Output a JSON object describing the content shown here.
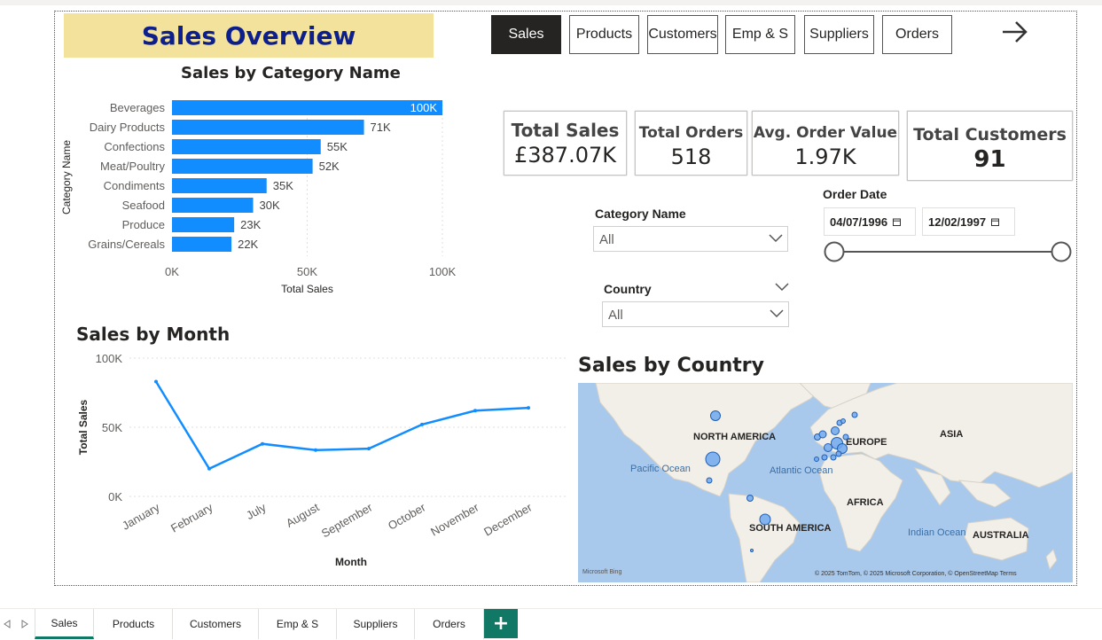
{
  "header": {
    "title": "Sales Overview"
  },
  "nav": {
    "buttons": [
      "Sales",
      "Products",
      "Customers",
      "Emp & S",
      "Suppliers",
      "Orders"
    ],
    "active": "Sales"
  },
  "cards": {
    "total_sales": {
      "label": "Total Sales",
      "value": "£387.07K"
    },
    "total_orders": {
      "label": "Total Orders",
      "value": "518"
    },
    "avg_order_value": {
      "label": "Avg. Order Value",
      "value": "1.97K"
    },
    "total_customers": {
      "label": "Total Customers",
      "value": "91"
    }
  },
  "slicers": {
    "category": {
      "title": "Category Name",
      "value": "All"
    },
    "country": {
      "title": "Country",
      "value": "All"
    },
    "order_date": {
      "title": "Order Date",
      "start": "04/07/1996",
      "end": "12/02/1997"
    }
  },
  "map": {
    "title": "Sales by Country",
    "labels": {
      "north_america": "NORTH AMERICA",
      "europe": "EUROPE",
      "asia": "ASIA",
      "africa": "AFRICA",
      "south_america": "SOUTH AMERICA",
      "australia": "AUSTRALIA",
      "pacific": "Pacific Ocean",
      "atlantic": "Atlantic Ocean",
      "indian": "Indian Ocean"
    },
    "attribution": "© 2025 TomTom, © 2025 Microsoft Corporation, © OpenStreetMap Terms",
    "brand": "Microsoft Bing"
  },
  "tabs": [
    "Sales",
    "Products",
    "Customers",
    "Emp & S",
    "Suppliers",
    "Orders"
  ],
  "colors": {
    "accent": "#118dff",
    "title_bg": "#f2e29b",
    "title_text": "#0d1f8c",
    "tab_green": "#117865"
  },
  "chart_data": [
    {
      "type": "bar",
      "orientation": "horizontal",
      "title": "Sales by Category Name",
      "ylabel": "Category Name",
      "xlabel": "Total Sales",
      "categories": [
        "Beverages",
        "Dairy Products",
        "Confections",
        "Meat/Poultry",
        "Condiments",
        "Seafood",
        "Produce",
        "Grains/Cereals"
      ],
      "values": [
        100000,
        71000,
        55000,
        52000,
        35000,
        30000,
        23000,
        22000
      ],
      "data_labels": [
        "100K",
        "71K",
        "55K",
        "52K",
        "35K",
        "30K",
        "23K",
        "22K"
      ],
      "xticks": [
        "0K",
        "50K",
        "100K"
      ],
      "xlim": [
        0,
        100000
      ]
    },
    {
      "type": "line",
      "title": "Sales by Month",
      "xlabel": "Month",
      "ylabel": "Total Sales",
      "categories": [
        "January",
        "February",
        "July",
        "August",
        "September",
        "October",
        "November",
        "December"
      ],
      "values": [
        83000,
        20000,
        38000,
        33500,
        34500,
        52000,
        62000,
        64000
      ],
      "yticks": [
        "0K",
        "50K",
        "100K"
      ],
      "ylim": [
        0,
        100000
      ]
    }
  ]
}
